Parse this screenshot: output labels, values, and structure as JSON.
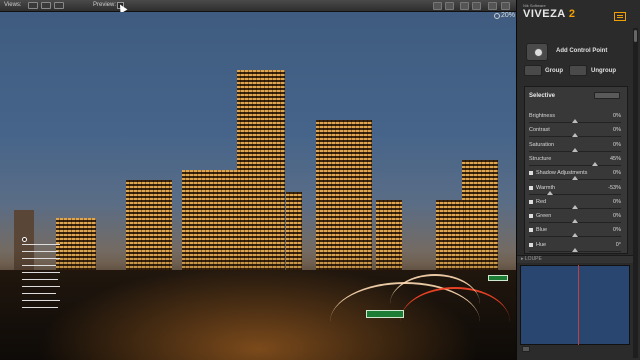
{
  "toolbar": {
    "views_label": "Views:",
    "preview_label": "Preview:",
    "zoom": "20%"
  },
  "brand": {
    "company": "Nik Software",
    "product": "VIVEZA",
    "version": "2"
  },
  "actions": {
    "add_control_point": "Add Control Point",
    "group": "Group",
    "ungroup": "Ungroup"
  },
  "selective": {
    "title": "Selective",
    "sliders": [
      {
        "label": "Brightness",
        "value": "0%",
        "level": 0.5
      },
      {
        "label": "Contrast",
        "value": "0%",
        "level": 0.5
      },
      {
        "label": "Saturation",
        "value": "0%",
        "level": 0.5
      },
      {
        "label": "Structure",
        "value": "45%",
        "level": 0.72
      },
      {
        "label": "Shadow Adjustments",
        "value": "0%",
        "level": 0.5
      },
      {
        "label": "Warmth",
        "value": "-53%",
        "level": 0.23
      },
      {
        "label": "Red",
        "value": "0%",
        "level": 0.5
      },
      {
        "label": "Green",
        "value": "0%",
        "level": 0.5
      },
      {
        "label": "Blue",
        "value": "0%",
        "level": 0.5
      },
      {
        "label": "Hue",
        "value": "0°",
        "level": 0.5
      }
    ]
  },
  "loupe": {
    "label": "LOUPE"
  }
}
